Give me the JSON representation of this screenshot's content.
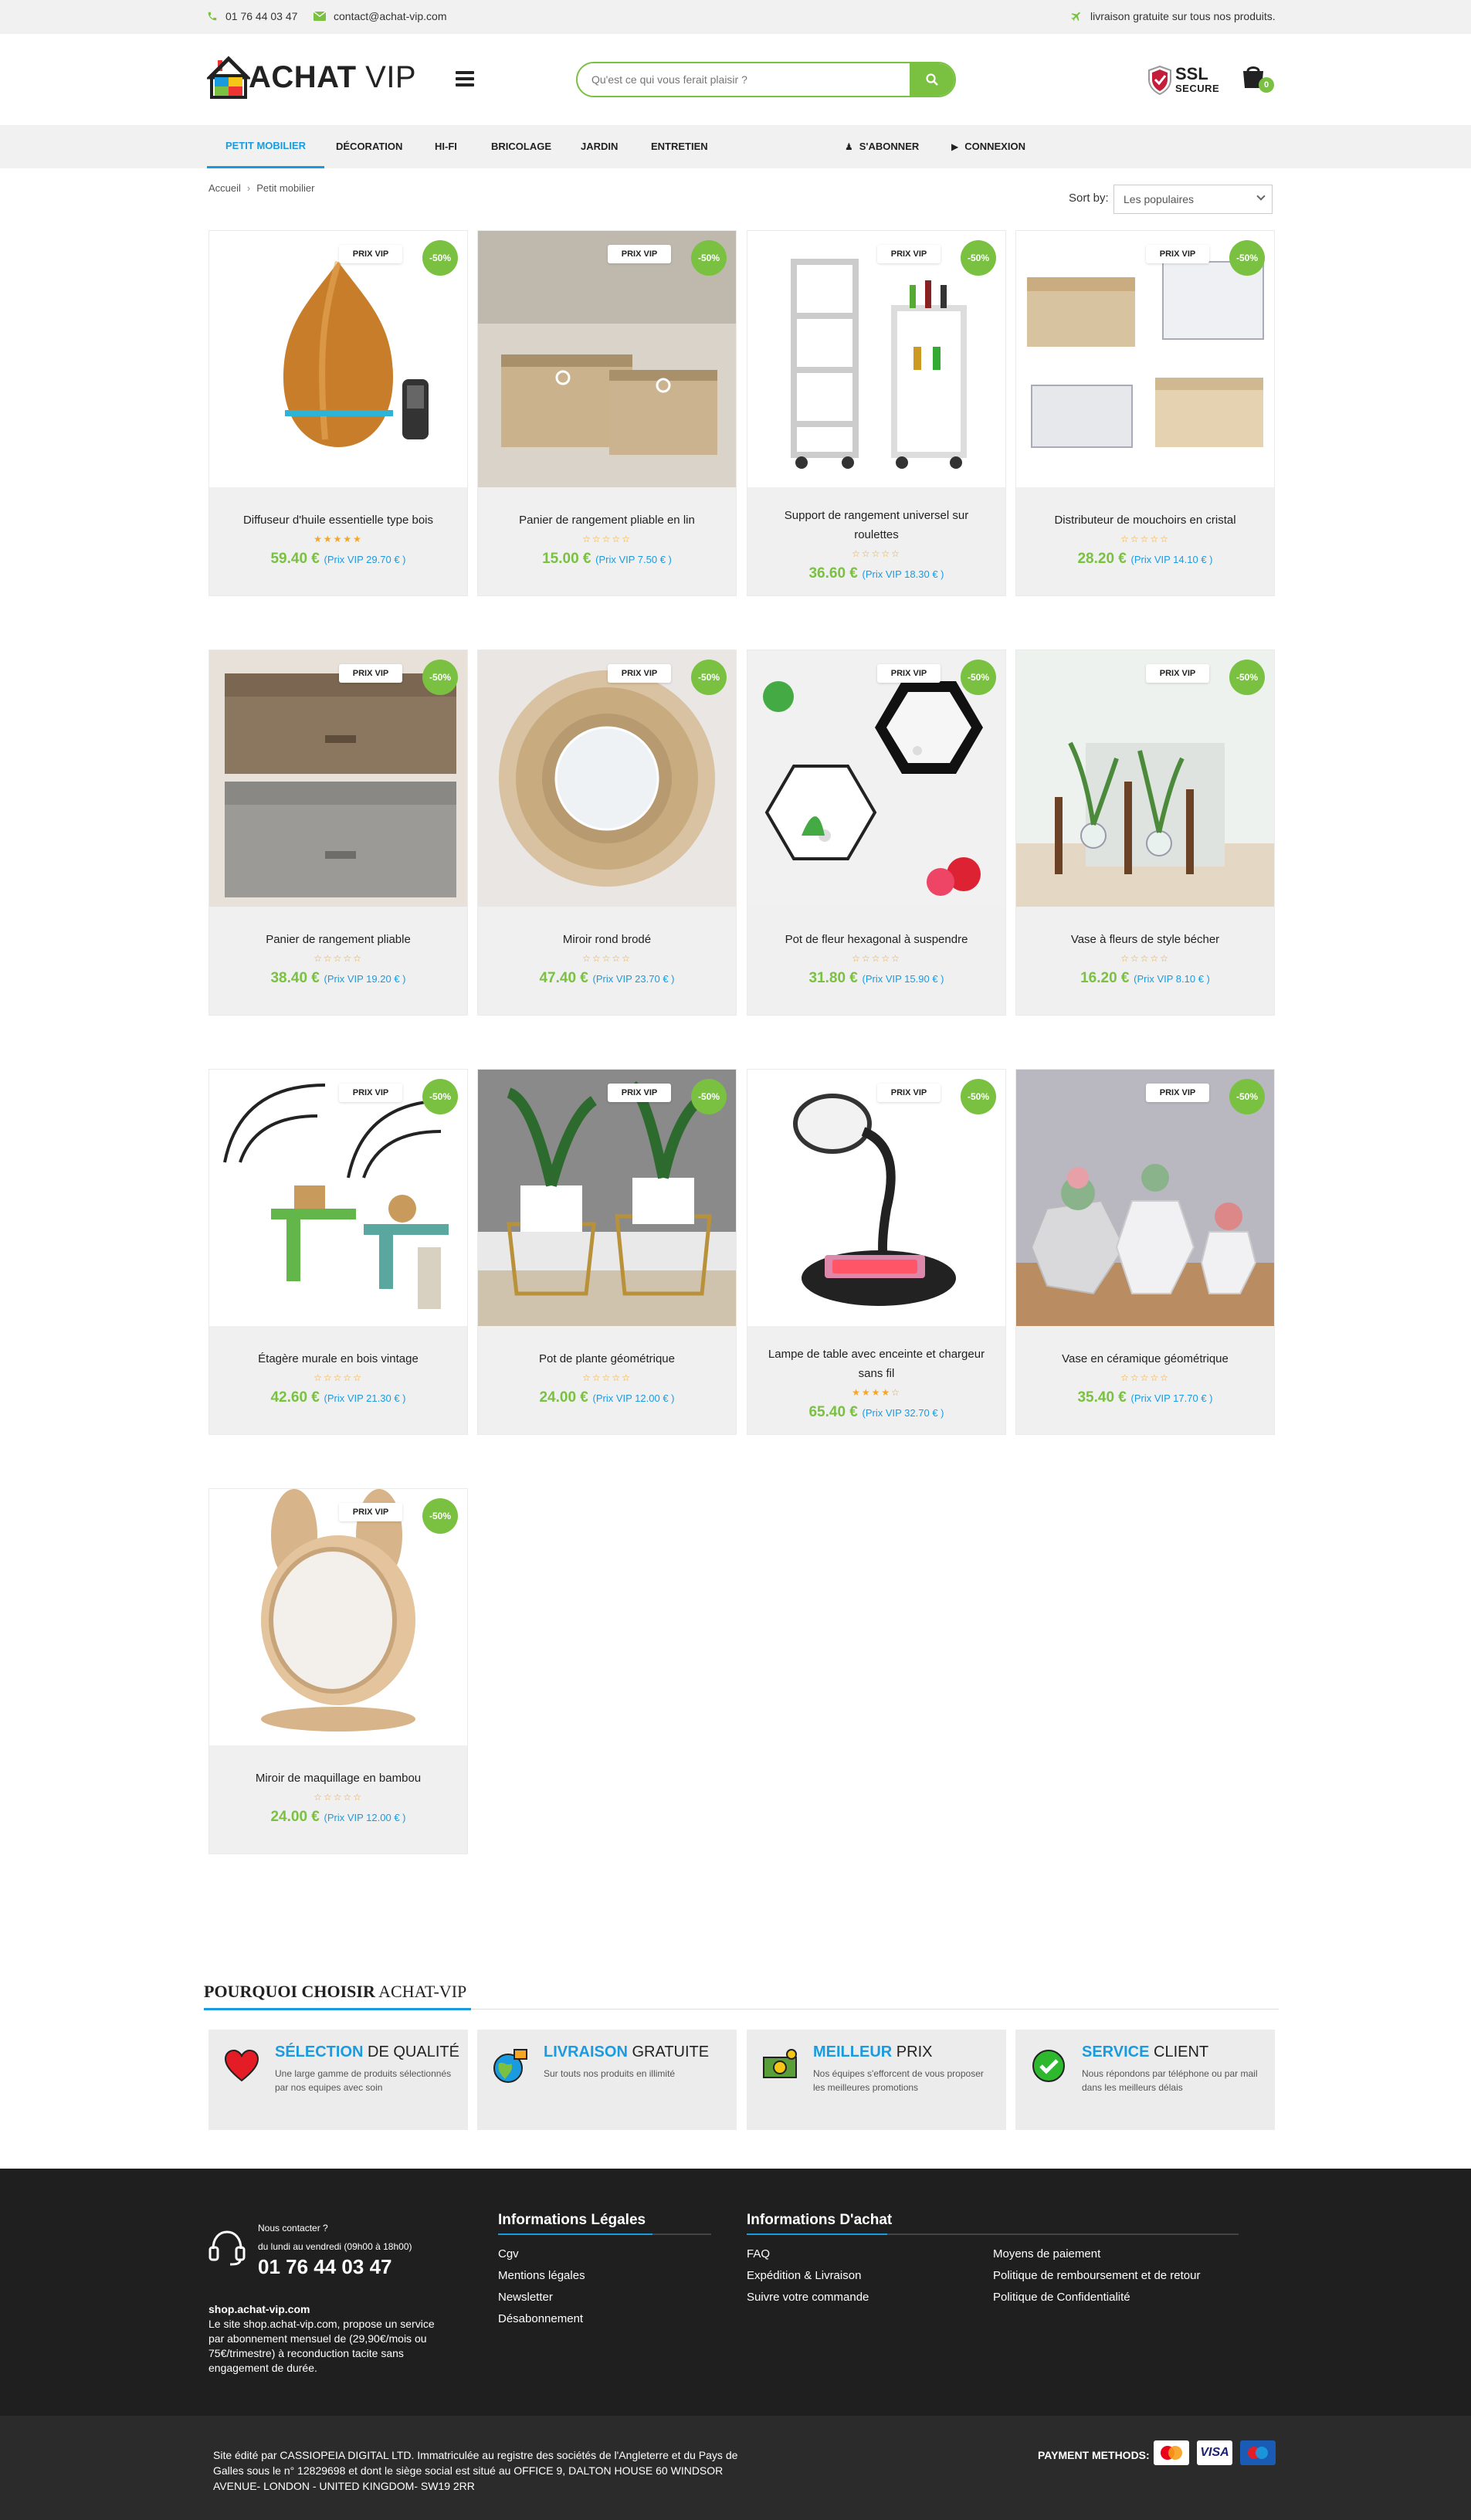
{
  "topbar": {
    "phone": "01 76 44 03 47",
    "email": "contact@achat-vip.com",
    "shipping": "livraison gratuite sur tous nos produits."
  },
  "header": {
    "logo_text_1": "ACHAT",
    "logo_text_2": "VIP",
    "search_placeholder": "Qu'est ce qui vous ferait plaisir ?",
    "ssl_line1": "SSL",
    "ssl_line2": "SECURE",
    "cart_count": "0"
  },
  "nav": {
    "items": [
      {
        "label": "PETIT MOBILIER",
        "active": true
      },
      {
        "label": "DÉCORATION"
      },
      {
        "label": "HI-FI"
      },
      {
        "label": "BRICOLAGE"
      },
      {
        "label": "JARDIN"
      },
      {
        "label": "ENTRETIEN"
      }
    ],
    "subscribe": "S'ABONNER",
    "login": "CONNEXION"
  },
  "breadcrumb": {
    "home": "Accueil",
    "sep": "›",
    "current": "Petit mobilier"
  },
  "sort": {
    "label": "Sort by:",
    "selected": "Les populaires"
  },
  "products": [
    {
      "name": "Diffuseur d'huile essentielle type bois",
      "vip_badge": "PRIX VIP",
      "discount": "-50%",
      "price": "59.40 €",
      "vip_price": "(Prix VIP 29.70 € )",
      "rating": 4.5,
      "stars": "★★★★★"
    },
    {
      "name": "Panier de rangement pliable en lin",
      "vip_badge": "PRIX VIP",
      "discount": "-50%",
      "price": "15.00 €",
      "vip_price": "(Prix VIP 7.50 € )",
      "rating": 0,
      "stars": "☆☆☆☆☆"
    },
    {
      "name": "Support de rangement universel sur roulettes",
      "vip_badge": "PRIX VIP",
      "discount": "-50%",
      "price": "36.60 €",
      "vip_price": "(Prix VIP 18.30 € )",
      "rating": 0,
      "stars": "☆☆☆☆☆"
    },
    {
      "name": "Distributeur de mouchoirs en cristal",
      "vip_badge": "PRIX VIP",
      "discount": "-50%",
      "price": "28.20 €",
      "vip_price": "(Prix VIP 14.10 € )",
      "rating": 0,
      "stars": "☆☆☆☆☆"
    },
    {
      "name": "Panier de rangement pliable",
      "vip_badge": "PRIX VIP",
      "discount": "-50%",
      "price": "38.40 €",
      "vip_price": "(Prix VIP 19.20 € )",
      "rating": 0,
      "stars": "☆☆☆☆☆"
    },
    {
      "name": "Miroir rond brodé",
      "vip_badge": "PRIX VIP",
      "discount": "-50%",
      "price": "47.40 €",
      "vip_price": "(Prix VIP 23.70 € )",
      "rating": 0,
      "stars": "☆☆☆☆☆"
    },
    {
      "name": "Pot de fleur hexagonal à suspendre",
      "vip_badge": "PRIX VIP",
      "discount": "-50%",
      "price": "31.80 €",
      "vip_price": "(Prix VIP 15.90 € )",
      "rating": 0,
      "stars": "☆☆☆☆☆"
    },
    {
      "name": "Vase à fleurs de style bécher",
      "vip_badge": "PRIX VIP",
      "discount": "-50%",
      "price": "16.20 €",
      "vip_price": "(Prix VIP 8.10 € )",
      "rating": 0,
      "stars": "☆☆☆☆☆"
    },
    {
      "name": "Étagère murale en bois vintage",
      "vip_badge": "PRIX VIP",
      "discount": "-50%",
      "price": "42.60 €",
      "vip_price": "(Prix VIP 21.30 € )",
      "rating": 0,
      "stars": "☆☆☆☆☆"
    },
    {
      "name": "Pot de plante géométrique",
      "vip_badge": "PRIX VIP",
      "discount": "-50%",
      "price": "24.00 €",
      "vip_price": "(Prix VIP 12.00 € )",
      "rating": 0,
      "stars": "☆☆☆☆☆"
    },
    {
      "name": "Lampe de table avec enceinte et chargeur sans fil",
      "vip_badge": "PRIX VIP",
      "discount": "-50%",
      "price": "65.40 €",
      "vip_price": "(Prix VIP 32.70 € )",
      "rating": 4,
      "stars": "★★★★☆"
    },
    {
      "name": "Vase en céramique géométrique",
      "vip_badge": "PRIX VIP",
      "discount": "-50%",
      "price": "35.40 €",
      "vip_price": "(Prix VIP 17.70 € )",
      "rating": 0,
      "stars": "☆☆☆☆☆"
    },
    {
      "name": "Miroir de maquillage en bambou",
      "vip_badge": "PRIX VIP",
      "discount": "-50%",
      "price": "24.00 €",
      "vip_price": "(Prix VIP 12.00 € )",
      "rating": 0,
      "stars": "☆☆☆☆☆"
    }
  ],
  "why": {
    "title_bold": "POURQUOI CHOISIR",
    "title_rest": "ACHAT-VIP",
    "cards": [
      {
        "hl": "SÉLECTION",
        "rest": "DE QUALITÉ",
        "desc": "Une large gamme de produits sélectionnés par nos equipes avec soin",
        "icon": "heart-icon"
      },
      {
        "hl": "LIVRAISON",
        "rest": "GRATUITE",
        "desc": "Sur touts nos produits en illimité",
        "icon": "globe-cart-icon"
      },
      {
        "hl": "MEILLEUR",
        "rest": "PRIX",
        "desc": "Nos équipes s'efforcent de vous proposer les meilleures promotions",
        "icon": "money-icon"
      },
      {
        "hl": "SERVICE",
        "rest": "CLIENT",
        "desc": "Nous répondons par téléphone ou par mail dans les meilleurs délais",
        "icon": "check-icon"
      }
    ]
  },
  "footer": {
    "contact_label": "Nous contacter ?",
    "hours": "du lundi au vendredi (09h00 à 18h00)",
    "phone": "01 76 44 03 47",
    "site_title": "shop.achat-vip.com",
    "site_desc": "Le site shop.achat-vip.com, propose un service par abonnement mensuel de (29,90€/mois ou 75€/trimestre) à reconduction tacite sans engagement de durée.",
    "legal_title": "Informations Légales",
    "legal_links": [
      "Cgv",
      "Mentions légales",
      "Newsletter",
      "Désabonnement"
    ],
    "achat_title": "Informations D'achat",
    "achat_links_col1": [
      "FAQ",
      "Expédition & Livraison",
      "Suivre votre commande"
    ],
    "achat_links_col2": [
      "Moyens de paiement",
      "Politique de remboursement et de retour",
      "Politique de Confidentialité"
    ]
  },
  "bottom": {
    "legal": "Site édité par CASSIOPEIA DIGITAL LTD. Immatriculée au registre des sociétés de l'Angleterre et du Pays de Galles sous le n° 12829698 et dont le siège social est situé au OFFICE 9, DALTON HOUSE 60 WINDSOR AVENUE- LONDON - UNITED KINGDOM- SW19 2RR",
    "payment_label": "PAYMENT METHODS:",
    "payment_cards": [
      "mastercard",
      "VISA",
      "maestro"
    ]
  },
  "colors": {
    "green": "#7ac141",
    "blue": "#1a9be0"
  }
}
